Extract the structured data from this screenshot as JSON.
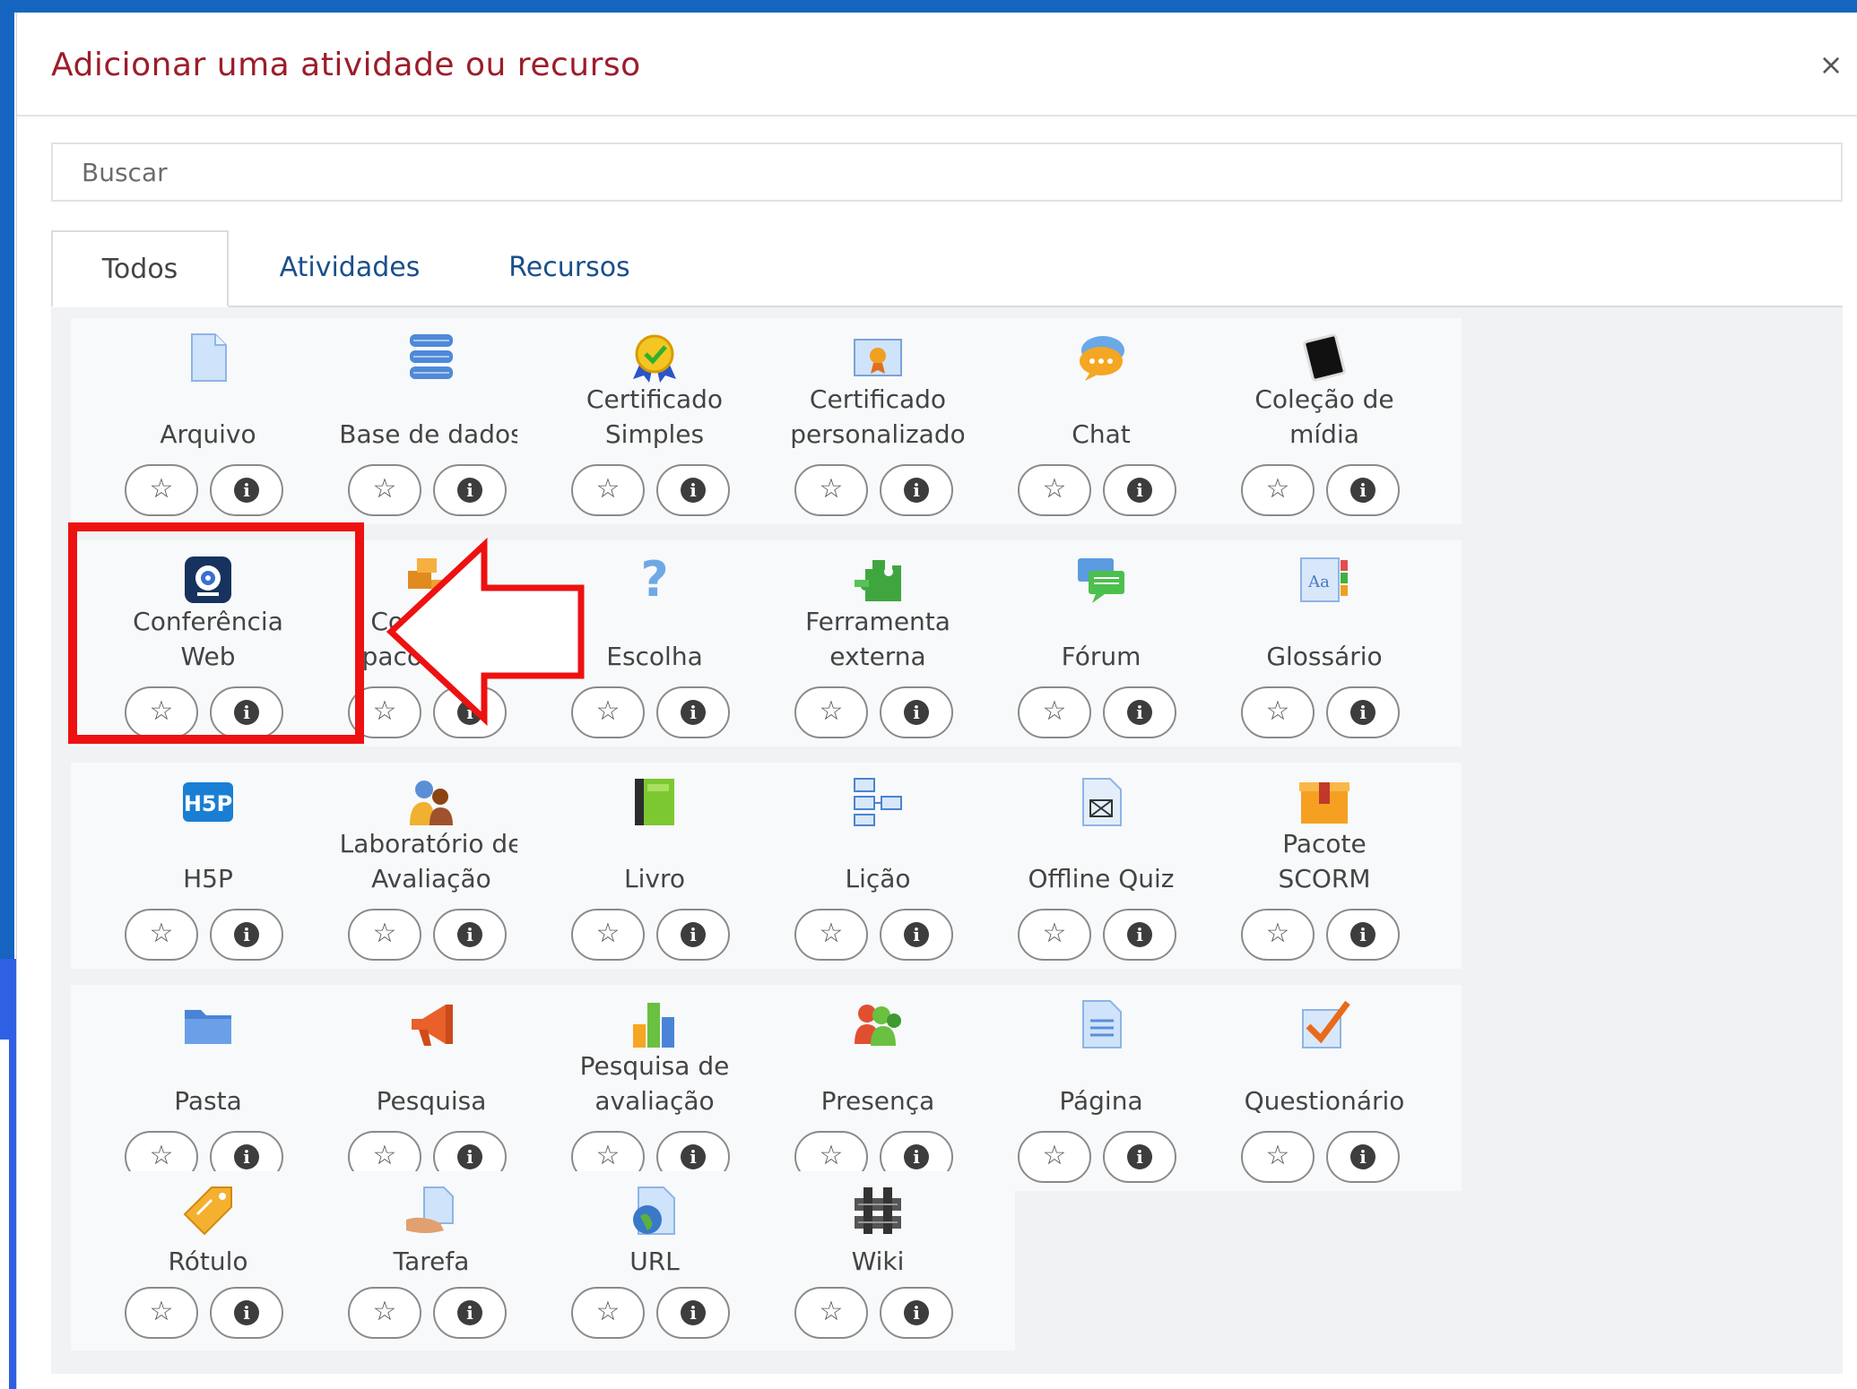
{
  "dialog": {
    "title": "Adicionar uma atividade ou recurso",
    "close_label": "×"
  },
  "search": {
    "placeholder": "Buscar",
    "value": ""
  },
  "tabs": [
    {
      "label": "Todos",
      "active": true
    },
    {
      "label": "Atividades",
      "active": false
    },
    {
      "label": "Recursos",
      "active": false
    }
  ],
  "buttons": {
    "star": "☆",
    "info": "i"
  },
  "items": [
    {
      "label": "Arquivo",
      "lines": [
        "Arquivo"
      ],
      "icon": "file-icon"
    },
    {
      "label": "Base de dados",
      "lines": [
        "Base de dados"
      ],
      "icon": "database-icon"
    },
    {
      "label": "Certificado Simples",
      "lines": [
        "Certificado",
        "Simples"
      ],
      "icon": "certificate-ribbon-icon"
    },
    {
      "label": "Certificado personalizado",
      "lines": [
        "Certificado",
        "personalizado"
      ],
      "icon": "certificate-badge-icon"
    },
    {
      "label": "Chat",
      "lines": [
        "Chat"
      ],
      "icon": "chat-bubble-icon"
    },
    {
      "label": "Coleção de mídia",
      "lines": [
        "Coleção de",
        "mídia"
      ],
      "icon": "media-tablet-icon"
    },
    {
      "label": "Conferência Web",
      "lines": [
        "Conferência",
        "Web"
      ],
      "icon": "webcam-icon"
    },
    {
      "label": "Conteúdo pacote IMS",
      "lines": [
        "Conteúdo",
        "pacote IMS"
      ],
      "icon": "ims-package-icon"
    },
    {
      "label": "Escolha",
      "lines": [
        "Escolha"
      ],
      "icon": "question-mark-icon"
    },
    {
      "label": "Ferramenta externa",
      "lines": [
        "Ferramenta",
        "externa"
      ],
      "icon": "puzzle-icon"
    },
    {
      "label": "Fórum",
      "lines": [
        "Fórum"
      ],
      "icon": "forum-bubbles-icon"
    },
    {
      "label": "Glossário",
      "lines": [
        "Glossário"
      ],
      "icon": "glossary-icon"
    },
    {
      "label": "H5P",
      "lines": [
        "H5P"
      ],
      "icon": "h5p-icon"
    },
    {
      "label": "Laboratório de Avaliação",
      "lines": [
        "Laboratório de",
        "Avaliação"
      ],
      "icon": "workshop-people-icon"
    },
    {
      "label": "Livro",
      "lines": [
        "Livro"
      ],
      "icon": "book-icon"
    },
    {
      "label": "Lição",
      "lines": [
        "Lição"
      ],
      "icon": "lesson-flow-icon"
    },
    {
      "label": "Offline Quiz",
      "lines": [
        "Offline Quiz"
      ],
      "icon": "offline-quiz-icon"
    },
    {
      "label": "Pacote SCORM",
      "lines": [
        "Pacote",
        "SCORM"
      ],
      "icon": "scorm-box-icon"
    },
    {
      "label": "Pasta",
      "lines": [
        "Pasta"
      ],
      "icon": "folder-icon"
    },
    {
      "label": "Pesquisa",
      "lines": [
        "Pesquisa"
      ],
      "icon": "megaphone-icon"
    },
    {
      "label": "Pesquisa de avaliação",
      "lines": [
        "Pesquisa de",
        "avaliação"
      ],
      "icon": "bar-chart-icon"
    },
    {
      "label": "Presença",
      "lines": [
        "Presença"
      ],
      "icon": "attendance-people-icon"
    },
    {
      "label": "Página",
      "lines": [
        "Página"
      ],
      "icon": "page-icon"
    },
    {
      "label": "Questionário",
      "lines": [
        "Questionário"
      ],
      "icon": "quiz-check-icon"
    },
    {
      "label": "Rótulo",
      "lines": [
        "Rótulo"
      ],
      "icon": "label-tag-icon"
    },
    {
      "label": "Tarefa",
      "lines": [
        "Tarefa"
      ],
      "icon": "assignment-hand-icon"
    },
    {
      "label": "URL",
      "lines": [
        "URL"
      ],
      "icon": "url-globe-icon"
    },
    {
      "label": "Wiki",
      "lines": [
        "Wiki"
      ],
      "icon": "wiki-icon"
    }
  ],
  "colors": {
    "title": "#9c1d2a",
    "tab_link": "#1a4f8b",
    "highlight": "#ee1111",
    "frame": "#1565c0"
  }
}
